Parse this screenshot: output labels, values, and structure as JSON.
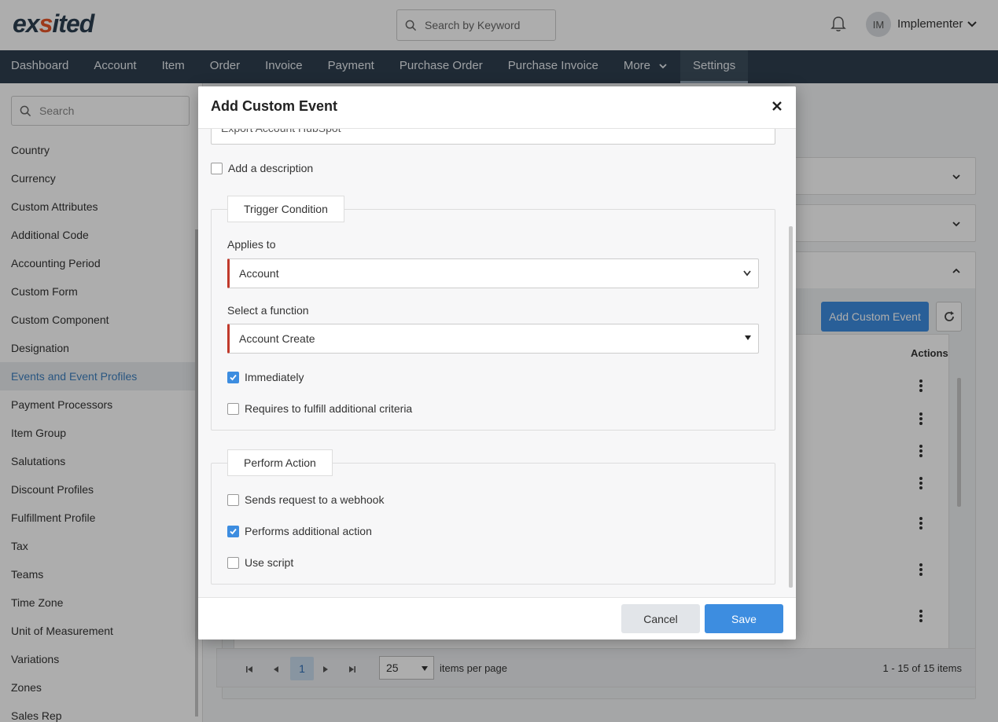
{
  "header": {
    "logo_left": "ex",
    "logo_accent": "s",
    "logo_right": "ited",
    "search_placeholder": "Search by Keyword",
    "avatar_initials": "IM",
    "user_name": "Implementer"
  },
  "nav": {
    "items": [
      "Dashboard",
      "Account",
      "Item",
      "Order",
      "Invoice",
      "Payment",
      "Purchase Order",
      "Purchase Invoice",
      "More",
      "Settings"
    ],
    "active": "Settings"
  },
  "sidebar": {
    "search_placeholder": "Search",
    "items": [
      "Country",
      "Currency",
      "Custom Attributes",
      "Additional Code",
      "Accounting Period",
      "Custom Form",
      "Custom Component",
      "Designation",
      "Events and Event Profiles",
      "Payment Processors",
      "Item Group",
      "Salutations",
      "Discount Profiles",
      "Fulfillment Profile",
      "Tax",
      "Teams",
      "Time Zone",
      "Unit of Measurement",
      "Variations",
      "Zones",
      "Sales Rep"
    ],
    "active_index": 8
  },
  "background": {
    "add_custom_event": "Add Custom Event",
    "actions_header": "Actions",
    "pager": {
      "page": "1",
      "page_size": "25",
      "items_per_page": "items per page",
      "info": "1 - 15 of 15 items"
    }
  },
  "modal": {
    "title": "Add Custom Event",
    "name_value": "Export Account HubSpot",
    "add_description": "Add a description",
    "add_description_checked": false,
    "trigger": {
      "legend": "Trigger Condition",
      "applies_to_label": "Applies to",
      "applies_to_value": "Account",
      "function_label": "Select a function",
      "function_value": "Account Create",
      "immediately": "Immediately",
      "immediately_checked": true,
      "additional_criteria": "Requires to fulfill additional criteria",
      "additional_criteria_checked": false
    },
    "action": {
      "legend": "Perform Action",
      "webhook": "Sends request to a webhook",
      "webhook_checked": false,
      "additional_action": "Performs additional action",
      "additional_action_checked": true,
      "use_script": "Use script",
      "use_script_checked": false
    },
    "cancel": "Cancel",
    "save": "Save"
  },
  "colors": {
    "nav_bg": "#2e3f4f",
    "accent": "#3d8de0",
    "required_border": "#c0392b",
    "active_sidebar_text": "#3d7fbf"
  }
}
